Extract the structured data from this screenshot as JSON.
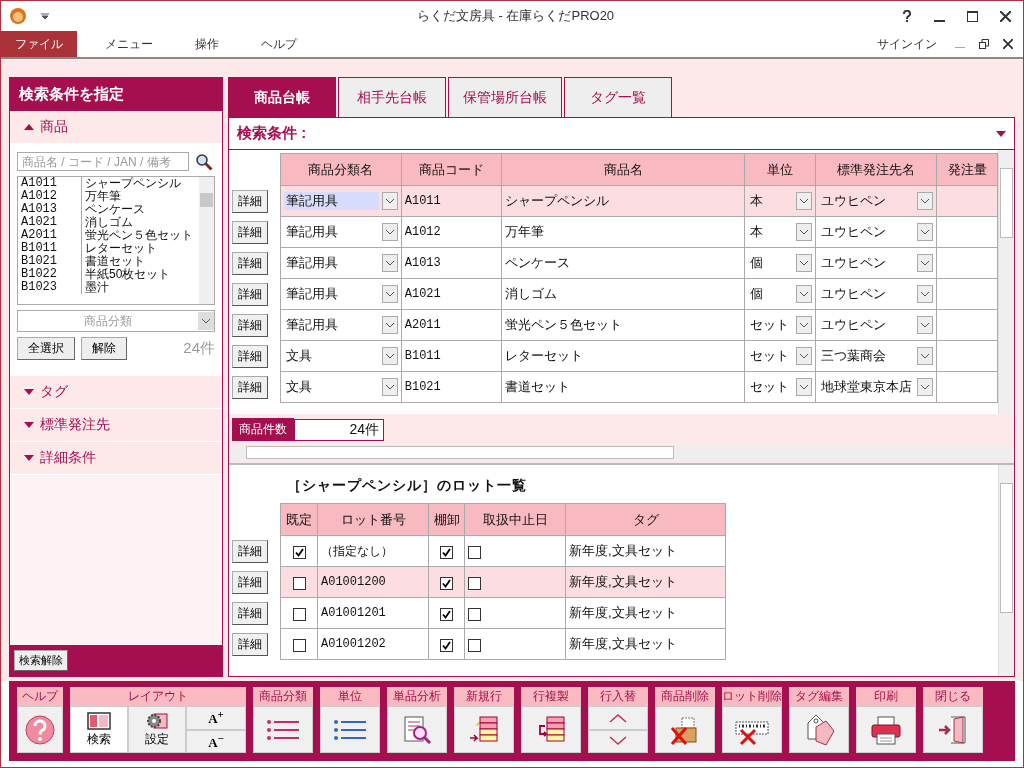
{
  "window": {
    "title": "らくだ文房具 - 在庫らくだPRO20"
  },
  "menu": [
    {
      "label": "ファイル",
      "selected": true
    },
    {
      "label": "メニュー",
      "selected": false
    },
    {
      "label": "操作",
      "selected": false
    },
    {
      "label": "ヘルプ",
      "selected": false
    }
  ],
  "signin": "サインイン",
  "sidebar": {
    "title": "検索条件を指定",
    "sections": [
      {
        "label": "商品",
        "expanded": true
      },
      {
        "label": "タグ",
        "expanded": false
      },
      {
        "label": "標準発注先",
        "expanded": false
      },
      {
        "label": "詳細条件",
        "expanded": false
      }
    ],
    "search": {
      "placeholder": "商品名 / コード / JAN / 備考"
    },
    "list": [
      {
        "code": "A1011",
        "name": "シャープペンシル"
      },
      {
        "code": "A1012",
        "name": "万年筆"
      },
      {
        "code": "A1013",
        "name": "ペンケース"
      },
      {
        "code": "A1021",
        "name": "消しゴム"
      },
      {
        "code": "A2011",
        "name": "蛍光ペン５色セット"
      },
      {
        "code": "B1011",
        "name": "レターセット"
      },
      {
        "code": "B1021",
        "name": "書道セット"
      },
      {
        "code": "B1022",
        "name": "半紙50枚セット"
      },
      {
        "code": "B1023",
        "name": "墨汁"
      }
    ],
    "category": {
      "placeholder": "商品分類"
    },
    "buttons": [
      "全選択",
      "解除"
    ],
    "count": "24件",
    "clear_button": "検索解除"
  },
  "tabs": [
    {
      "label": "商品台帳",
      "selected": true
    },
    {
      "label": "相手先台帳",
      "selected": false
    },
    {
      "label": "保管場所台帳",
      "selected": false
    },
    {
      "label": "タグ一覧",
      "selected": false
    }
  ],
  "search_conditions": {
    "label": "検索条件 :"
  },
  "products": {
    "columns": [
      "商品分類名",
      "商品コード",
      "商品名",
      "単位",
      "標準発注先名",
      "発注量"
    ],
    "rows": [
      {
        "detail": "詳細",
        "category": "筆記用具",
        "code": "A1011",
        "name": "シャープペンシル",
        "unit": "本",
        "supplier": "ユウヒペン",
        "selected": true
      },
      {
        "detail": "詳細",
        "category": "筆記用具",
        "code": "A1012",
        "name": "万年筆",
        "unit": "本",
        "supplier": "ユウヒペン",
        "selected": false
      },
      {
        "detail": "詳細",
        "category": "筆記用具",
        "code": "A1013",
        "name": "ペンケース",
        "unit": "個",
        "supplier": "ユウヒペン",
        "selected": false
      },
      {
        "detail": "詳細",
        "category": "筆記用具",
        "code": "A1021",
        "name": "消しゴム",
        "unit": "個",
        "supplier": "ユウヒペン",
        "selected": false
      },
      {
        "detail": "詳細",
        "category": "筆記用具",
        "code": "A2011",
        "name": "蛍光ペン５色セット",
        "unit": "セット",
        "supplier": "ユウヒペン",
        "selected": false
      },
      {
        "detail": "詳細",
        "category": "文具",
        "code": "B1011",
        "name": "レターセット",
        "unit": "セット",
        "supplier": "三つ葉商会",
        "selected": false
      },
      {
        "detail": "詳細",
        "category": "文具",
        "code": "B1021",
        "name": "書道セット",
        "unit": "セット",
        "supplier": "地球堂東京本店",
        "selected": false
      }
    ],
    "count_label": "商品件数",
    "count": "24件"
  },
  "lots": {
    "title": "［シャープペンシル］のロット一覧",
    "columns": [
      "既定",
      "ロット番号",
      "棚卸",
      "取扱中止日",
      "タグ"
    ],
    "rows": [
      {
        "detail": "詳細",
        "default": true,
        "lot": "（指定なし）",
        "inventory": true,
        "discontinued": false,
        "tags": "新年度,文具セット",
        "selected": false
      },
      {
        "detail": "詳細",
        "default": false,
        "lot": "A01001200",
        "inventory": true,
        "discontinued": false,
        "tags": "新年度,文具セット",
        "selected": true
      },
      {
        "detail": "詳細",
        "default": false,
        "lot": "A01001201",
        "inventory": true,
        "discontinued": false,
        "tags": "新年度,文具セット",
        "selected": false
      },
      {
        "detail": "詳細",
        "default": false,
        "lot": "A01001202",
        "inventory": true,
        "discontinued": false,
        "tags": "新年度,文具セット",
        "selected": false
      }
    ]
  },
  "toolbar": [
    {
      "label": "ヘルプ",
      "kind": "help"
    },
    {
      "label": "レイアウト",
      "kind": "layout",
      "buttons": [
        {
          "label": "検索",
          "selected": true
        },
        {
          "label": "設定",
          "selected": false
        }
      ],
      "font_buttons": [
        "A$^{+}$",
        "A$^{−}$"
      ]
    },
    {
      "label": "商品分類",
      "kind": "category"
    },
    {
      "label": "単位",
      "kind": "unit"
    },
    {
      "label": "単品分析",
      "kind": "analysis"
    },
    {
      "label": "新規行",
      "kind": "new-row"
    },
    {
      "label": "行複製",
      "kind": "copy-row"
    },
    {
      "label": "行入替",
      "kind": "reorder"
    },
    {
      "label": "商品削除",
      "kind": "delete-product"
    },
    {
      "label": "ロット削除",
      "kind": "delete-lot"
    },
    {
      "label": "タグ編集",
      "kind": "tags"
    },
    {
      "label": "印刷",
      "kind": "print"
    },
    {
      "label": "閉じる",
      "kind": "close"
    }
  ]
}
